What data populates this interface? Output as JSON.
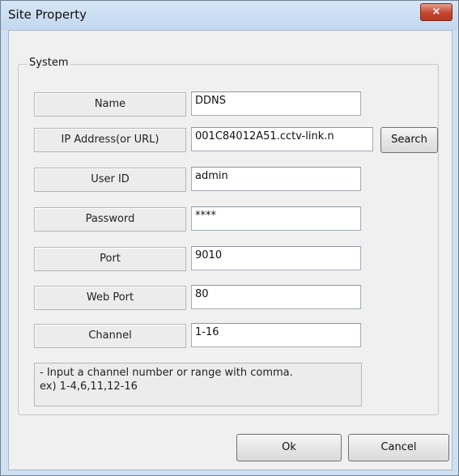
{
  "window": {
    "title": "Site Property",
    "close_symbol": "×"
  },
  "group": {
    "label": "System"
  },
  "fields": [
    {
      "label": "Name",
      "value": "DDNS"
    },
    {
      "label": "IP Address(or URL)",
      "value": "001C84012A51.cctv-link.n"
    },
    {
      "label": "User ID",
      "value": "admin"
    },
    {
      "label": "Password",
      "value": "****"
    },
    {
      "label": "Port",
      "value": "9010"
    },
    {
      "label": "Web Port",
      "value": "80"
    },
    {
      "label": "Channel",
      "value": "1-16"
    }
  ],
  "search_button": "Search",
  "hint": {
    "line1": "- Input a channel number or range with comma.",
    "line2": "  ex) 1-4,6,11,12-16"
  },
  "buttons": {
    "ok": "Ok",
    "cancel": "Cancel"
  }
}
